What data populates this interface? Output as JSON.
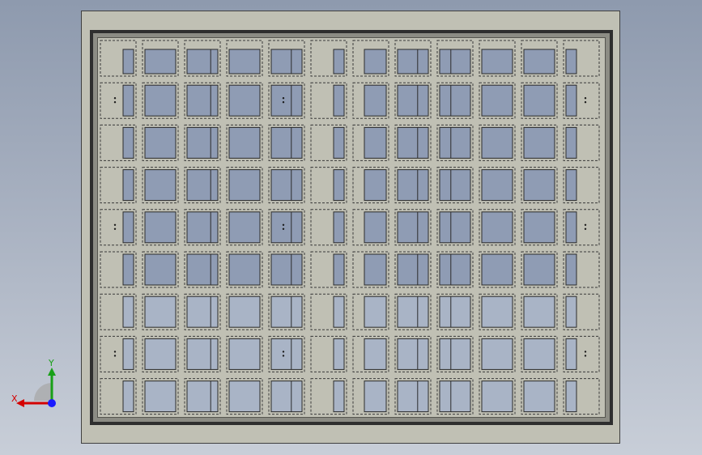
{
  "view": {
    "background_top": "#8e9aae",
    "background_bottom": "#c8ced8"
  },
  "plate": {
    "face_color": "#c0c0b4",
    "frame_color": "#2e2e2e",
    "bevel_color": "#8c8c84",
    "pocket_fill": "#8f9cb4",
    "pocket_fill_light": "#a9b4c6",
    "grid_rows": 9,
    "grid_cols": 12
  },
  "axis_triad": {
    "x_label": "X",
    "y_label": "Y",
    "x_color": "#d40000",
    "y_color": "#18a018",
    "z_color": "#1a1aff"
  }
}
